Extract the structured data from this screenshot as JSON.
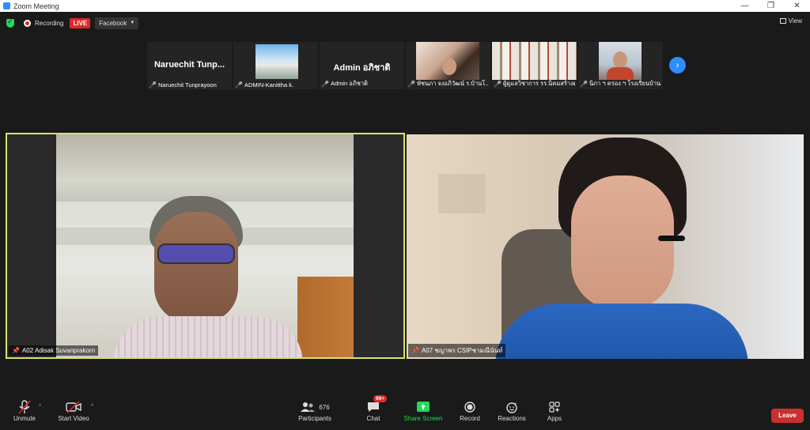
{
  "window": {
    "title": "Zoom Meeting"
  },
  "topbar": {
    "recording_label": "Recording",
    "live_label": "LIVE",
    "stream_target": "Facebook",
    "view_label": "View"
  },
  "strip": {
    "thumbs": [
      {
        "big_name": "Naruechit  Tunp...",
        "caption": "Naruechit Tunprayoon"
      },
      {
        "big_name": "",
        "caption": "ADMIN-Kanittha k."
      },
      {
        "big_name": "Admin อภิชาติ",
        "caption": "Admin อภิชาติ"
      },
      {
        "big_name": "",
        "caption": "พัชนภา จงอภิวัฒน์ ร.บ้านโ..."
      },
      {
        "big_name": "",
        "caption": "ผู้ดูแลวิชาการ รร.นิคมสร้างตนเอง..."
      },
      {
        "big_name": "",
        "caption": "นิภา ฯ ครอง ฯ โรงเรียนบ้าน..."
      }
    ]
  },
  "tiles": {
    "left_label": "A02 Adisak Suvanprakorn",
    "right_label": "A07 ชญาพร CSIPชามณีนันท์"
  },
  "toolbar": {
    "unmute": "Unmute",
    "start_video": "Start Video",
    "participants": "Participants",
    "participants_count": "676",
    "chat": "Chat",
    "chat_badge": "99+",
    "share_screen": "Share Screen",
    "record": "Record",
    "reactions": "Reactions",
    "apps": "Apps",
    "leave": "Leave"
  },
  "colors": {
    "accent": "#2d8cff",
    "share_green": "#23d959",
    "live_red": "#e02828",
    "leave_red": "#c8312f",
    "active_speaker": "#d8e36d"
  }
}
